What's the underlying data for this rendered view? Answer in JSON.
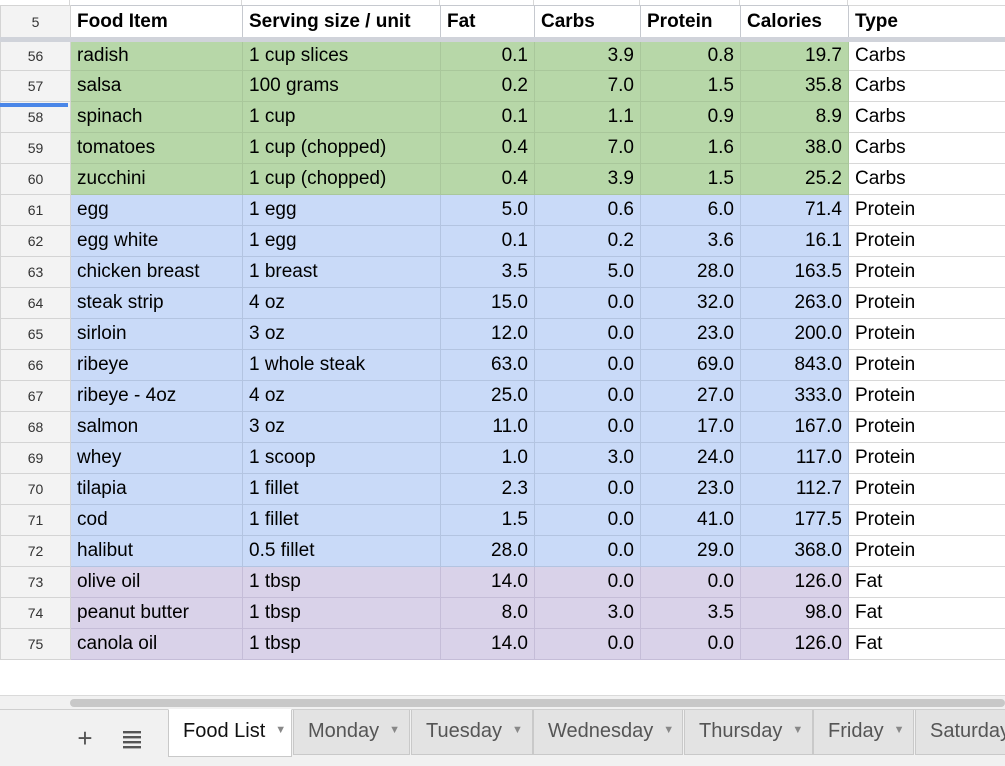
{
  "header": {
    "row_num": "5",
    "columns": [
      "Food Item",
      "Serving size / unit",
      "Fat",
      "Carbs",
      "Protein",
      "Calories",
      "Type"
    ]
  },
  "rows": [
    {
      "num": "56",
      "item": "radish",
      "serving": "1 cup slices",
      "fat": "0.1",
      "carbs": "3.9",
      "protein": "0.8",
      "calories": "19.7",
      "type": "Carbs",
      "group": "carbs"
    },
    {
      "num": "57",
      "item": "salsa",
      "serving": "100 grams",
      "fat": "0.2",
      "carbs": "7.0",
      "protein": "1.5",
      "calories": "35.8",
      "type": "Carbs",
      "group": "carbs"
    },
    {
      "num": "58",
      "item": "spinach",
      "serving": "1 cup",
      "fat": "0.1",
      "carbs": "1.1",
      "protein": "0.9",
      "calories": "8.9",
      "type": "Carbs",
      "group": "carbs"
    },
    {
      "num": "59",
      "item": "tomatoes",
      "serving": "1 cup (chopped)",
      "fat": "0.4",
      "carbs": "7.0",
      "protein": "1.6",
      "calories": "38.0",
      "type": "Carbs",
      "group": "carbs"
    },
    {
      "num": "60",
      "item": "zucchini",
      "serving": "1 cup (chopped)",
      "fat": "0.4",
      "carbs": "3.9",
      "protein": "1.5",
      "calories": "25.2",
      "type": "Carbs",
      "group": "carbs"
    },
    {
      "num": "61",
      "item": "egg",
      "serving": "1 egg",
      "fat": "5.0",
      "carbs": "0.6",
      "protein": "6.0",
      "calories": "71.4",
      "type": "Protein",
      "group": "protein"
    },
    {
      "num": "62",
      "item": "egg white",
      "serving": "1 egg",
      "fat": "0.1",
      "carbs": "0.2",
      "protein": "3.6",
      "calories": "16.1",
      "type": "Protein",
      "group": "protein"
    },
    {
      "num": "63",
      "item": "chicken breast",
      "serving": "1 breast",
      "fat": "3.5",
      "carbs": "5.0",
      "protein": "28.0",
      "calories": "163.5",
      "type": "Protein",
      "group": "protein"
    },
    {
      "num": "64",
      "item": "steak strip",
      "serving": "4 oz",
      "fat": "15.0",
      "carbs": "0.0",
      "protein": "32.0",
      "calories": "263.0",
      "type": "Protein",
      "group": "protein"
    },
    {
      "num": "65",
      "item": "sirloin",
      "serving": "3 oz",
      "fat": "12.0",
      "carbs": "0.0",
      "protein": "23.0",
      "calories": "200.0",
      "type": "Protein",
      "group": "protein"
    },
    {
      "num": "66",
      "item": "ribeye",
      "serving": "1 whole steak",
      "fat": "63.0",
      "carbs": "0.0",
      "protein": "69.0",
      "calories": "843.0",
      "type": "Protein",
      "group": "protein"
    },
    {
      "num": "67",
      "item": "ribeye - 4oz",
      "serving": "4 oz",
      "fat": "25.0",
      "carbs": "0.0",
      "protein": "27.0",
      "calories": "333.0",
      "type": "Protein",
      "group": "protein"
    },
    {
      "num": "68",
      "item": "salmon",
      "serving": "3 oz",
      "fat": "11.0",
      "carbs": "0.0",
      "protein": "17.0",
      "calories": "167.0",
      "type": "Protein",
      "group": "protein"
    },
    {
      "num": "69",
      "item": "whey",
      "serving": "1 scoop",
      "fat": "1.0",
      "carbs": "3.0",
      "protein": "24.0",
      "calories": "117.0",
      "type": "Protein",
      "group": "protein"
    },
    {
      "num": "70",
      "item": "tilapia",
      "serving": "1 fillet",
      "fat": "2.3",
      "carbs": "0.0",
      "protein": "23.0",
      "calories": "112.7",
      "type": "Protein",
      "group": "protein"
    },
    {
      "num": "71",
      "item": "cod",
      "serving": "1 fillet",
      "fat": "1.5",
      "carbs": "0.0",
      "protein": "41.0",
      "calories": "177.5",
      "type": "Protein",
      "group": "protein"
    },
    {
      "num": "72",
      "item": "halibut",
      "serving": "0.5 fillet",
      "fat": "28.0",
      "carbs": "0.0",
      "protein": "29.0",
      "calories": "368.0",
      "type": "Protein",
      "group": "protein"
    },
    {
      "num": "73",
      "item": "olive oil",
      "serving": "1 tbsp",
      "fat": "14.0",
      "carbs": "0.0",
      "protein": "0.0",
      "calories": "126.0",
      "type": "Fat",
      "group": "fat"
    },
    {
      "num": "74",
      "item": "peanut butter",
      "serving": "1 tbsp",
      "fat": "8.0",
      "carbs": "3.0",
      "protein": "3.5",
      "calories": "98.0",
      "type": "Fat",
      "group": "fat"
    },
    {
      "num": "75",
      "item": "canola oil",
      "serving": "1 tbsp",
      "fat": "14.0",
      "carbs": "0.0",
      "protein": "0.0",
      "calories": "126.0",
      "type": "Fat",
      "group": "fat"
    }
  ],
  "colors": {
    "carbs": "#b7d7a8",
    "protein": "#c9daf8",
    "fat": "#d9d2e9",
    "selection": "#4a86e8"
  },
  "toolbar": {
    "add_icon": "plus-icon",
    "list_icon": "sheet-list-icon"
  },
  "tabs": [
    "Food List",
    "Monday",
    "Tuesday",
    "Wednesday",
    "Thursday",
    "Friday",
    "Saturday"
  ],
  "active_tab": "Food List"
}
